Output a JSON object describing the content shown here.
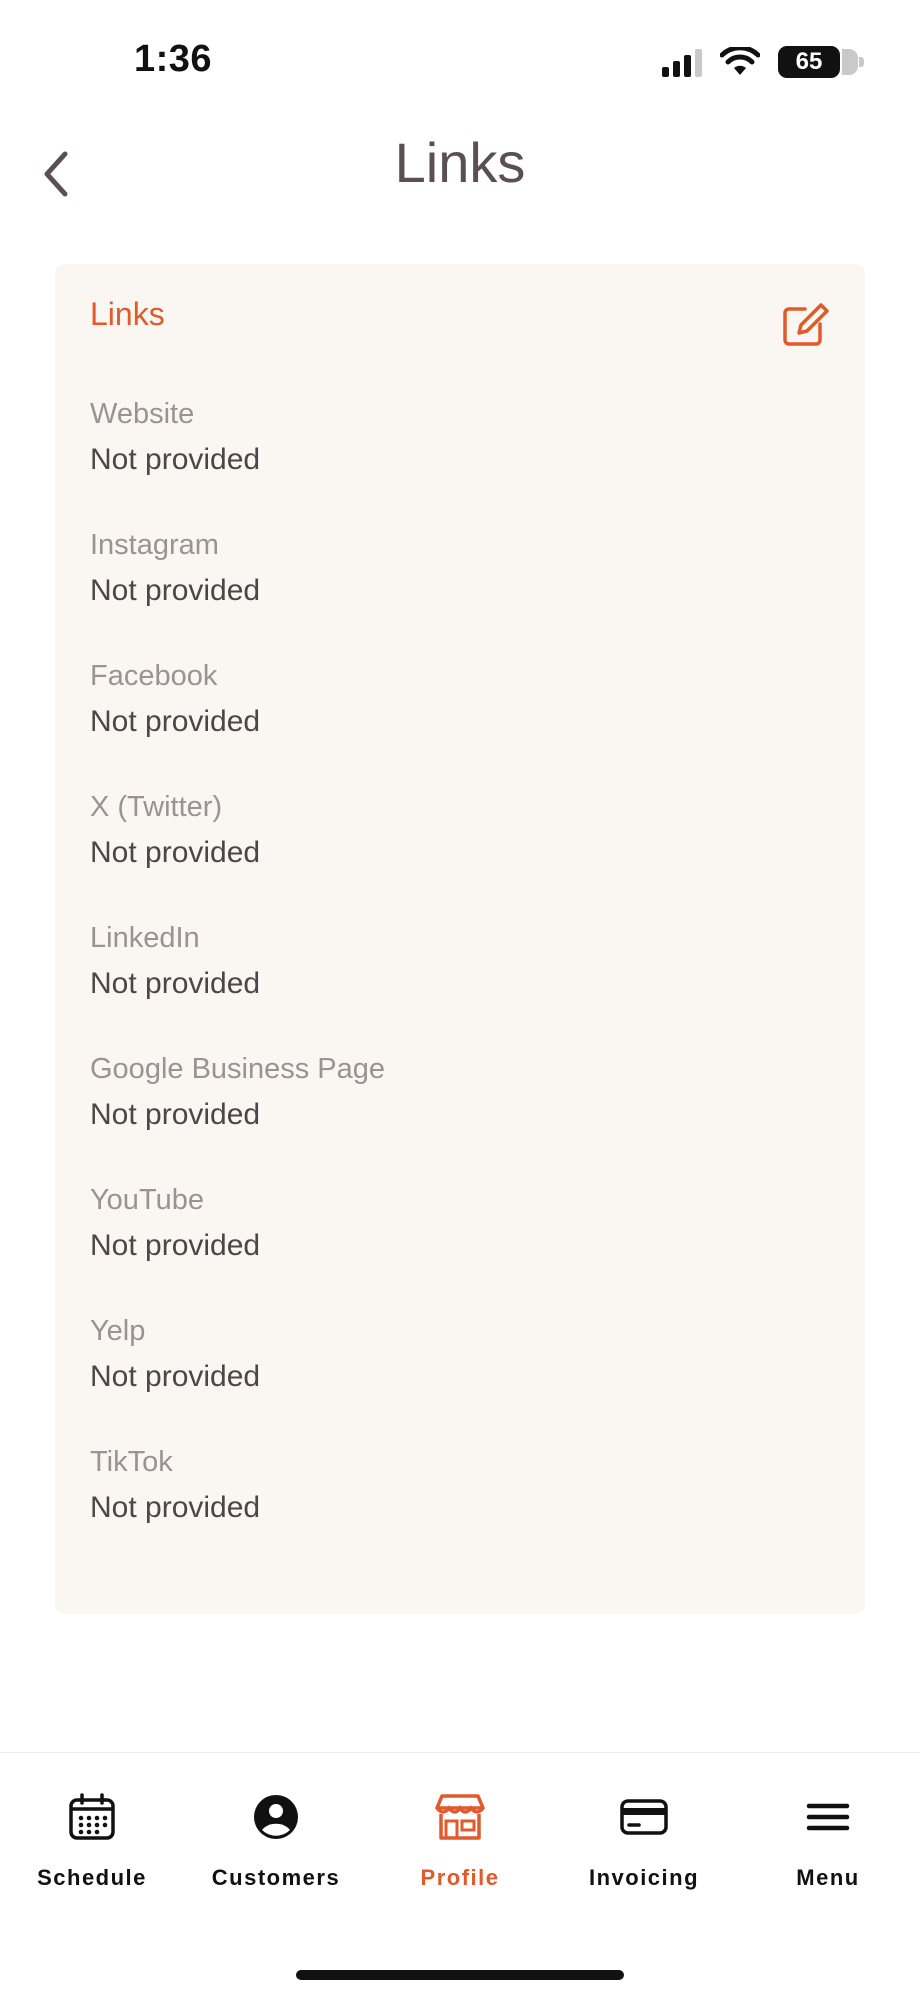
{
  "status_bar": {
    "time": "1:36",
    "battery": "65"
  },
  "header": {
    "title": "Links"
  },
  "card": {
    "title": "Links",
    "items": [
      {
        "label": "Website",
        "value": "Not provided"
      },
      {
        "label": "Instagram",
        "value": "Not provided"
      },
      {
        "label": "Facebook",
        "value": "Not provided"
      },
      {
        "label": "X (Twitter)",
        "value": "Not provided"
      },
      {
        "label": "LinkedIn",
        "value": "Not provided"
      },
      {
        "label": "Google Business Page",
        "value": "Not provided"
      },
      {
        "label": "YouTube",
        "value": "Not provided"
      },
      {
        "label": "Yelp",
        "value": "Not provided"
      },
      {
        "label": "TikTok",
        "value": "Not provided"
      }
    ]
  },
  "tab_bar": {
    "active": "Profile",
    "tabs": [
      {
        "label": "Schedule",
        "icon": "calendar-icon"
      },
      {
        "label": "Customers",
        "icon": "user-circle-icon"
      },
      {
        "label": "Profile",
        "icon": "storefront-icon"
      },
      {
        "label": "Invoicing",
        "icon": "credit-card-icon"
      },
      {
        "label": "Menu",
        "icon": "hamburger-menu-icon"
      }
    ]
  },
  "colors": {
    "accent": "#e05a2b",
    "card_bg": "#faf6f2",
    "title": "#5a4f52"
  }
}
